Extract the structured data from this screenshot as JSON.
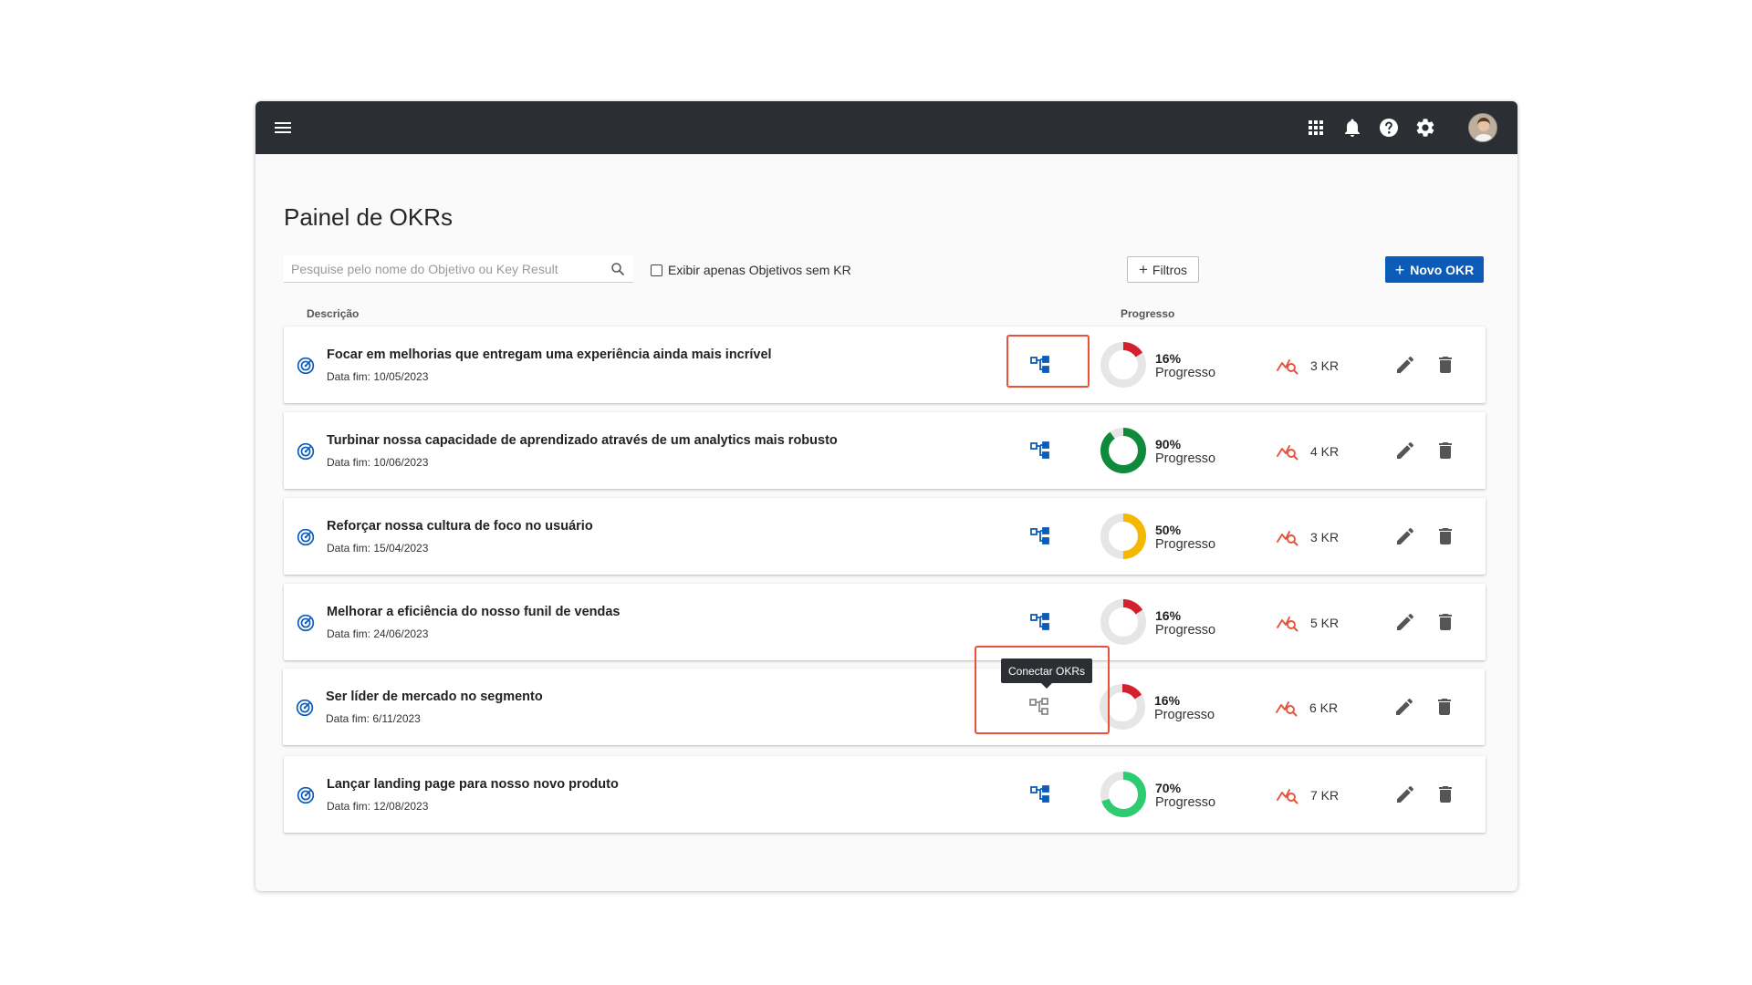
{
  "page": {
    "title": "Painel de OKRs"
  },
  "toolbar": {
    "search_placeholder": "Pesquise pelo nome do Objetivo ou Key Result",
    "checkbox_label": "Exibir apenas Objetivos sem KR",
    "checkbox_checked": false,
    "filters_label": "Filtros",
    "new_okr_label": "Novo OKR"
  },
  "columns": {
    "description": "Descrição",
    "progress": "Progresso"
  },
  "topbar_icons": [
    "menu-icon",
    "apps-grid-icon",
    "bell-icon",
    "help-icon",
    "gear-icon",
    "avatar"
  ],
  "colors": {
    "topbar": "#2b2e33",
    "primary": "#0b5cb8",
    "highlight": "#e8523a",
    "kr_icon": "#e8523a",
    "track": "#e6e6e6"
  },
  "tooltip": {
    "text": "Conectar OKRs"
  },
  "okrs": [
    {
      "title": "Focar em melhorias que entregam uma experiência ainda mais incrível",
      "date": "Data fim: 10/05/2023",
      "progress_value": 16,
      "progress_text": "16%",
      "progress_label": "Progresso",
      "progress_color": "#d4202d",
      "kr": "3 KR"
    },
    {
      "title": "Turbinar nossa capacidade de aprendizado através de um analytics mais robusto",
      "date": "Data fim: 10/06/2023",
      "progress_value": 90,
      "progress_text": "90%",
      "progress_label": "Progresso",
      "progress_color": "#0e8a3a",
      "kr": "4 KR"
    },
    {
      "title": "Reforçar nossa cultura de foco no usuário",
      "date": "Data fim: 15/04/2023",
      "progress_value": 50,
      "progress_text": "50%",
      "progress_label": "Progresso",
      "progress_color": "#f5b800",
      "kr": "3 KR"
    },
    {
      "title": "Melhorar a eficiência do nosso funil de vendas",
      "date": "Data fim: 24/06/2023",
      "progress_value": 16,
      "progress_text": "16%",
      "progress_label": "Progresso",
      "progress_color": "#d4202d",
      "kr": "5 KR"
    },
    {
      "title": "Ser líder de mercado no segmento",
      "date": "Data fim: 6/11/2023",
      "progress_value": 16,
      "progress_text": "16%",
      "progress_label": "Progresso",
      "progress_color": "#d4202d",
      "kr": "6 KR"
    },
    {
      "title": "Lançar landing page para nosso novo produto",
      "date": "Data fim: 12/08/2023",
      "progress_value": 70,
      "progress_text": "70%",
      "progress_label": "Progresso",
      "progress_color": "#2ecc71",
      "kr": "7 KR"
    }
  ]
}
